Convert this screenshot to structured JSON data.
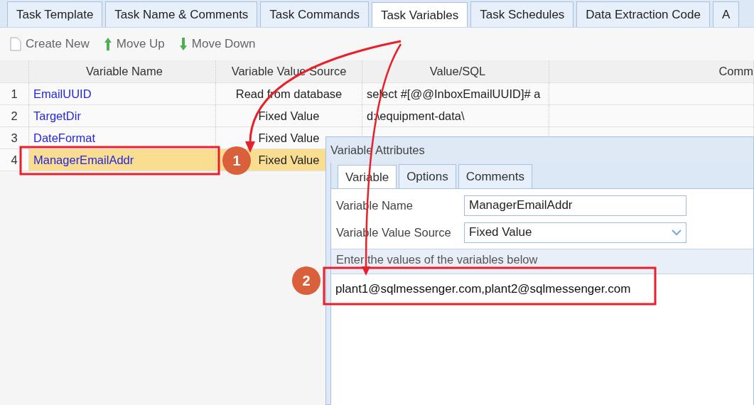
{
  "tabs": [
    {
      "label": "Task Template",
      "selected": false
    },
    {
      "label": "Task Name & Comments",
      "selected": false
    },
    {
      "label": "Task Commands",
      "selected": false
    },
    {
      "label": "Task Variables",
      "selected": true
    },
    {
      "label": "Task Schedules",
      "selected": false
    },
    {
      "label": "Data Extraction Code",
      "selected": false
    },
    {
      "label": "A",
      "selected": false
    }
  ],
  "toolbar": [
    {
      "kind": "new",
      "label": "Create New"
    },
    {
      "kind": "up",
      "label": "Move Up"
    },
    {
      "kind": "down",
      "label": "Move Down"
    }
  ],
  "table": {
    "columns": [
      "Variable Name",
      "Variable Value Source",
      "Value/SQL",
      "Comm"
    ],
    "rows": [
      {
        "number": "1",
        "name": "EmailUUID",
        "source": "Read from database",
        "value": "select #[@@InboxEmailUUID]# a",
        "selected": false
      },
      {
        "number": "2",
        "name": "TargetDir",
        "source": "Fixed Value",
        "value": "d:\\equipment-data\\",
        "selected": false
      },
      {
        "number": "3",
        "name": "DateFormat",
        "source": "Fixed Value",
        "selected": false
      },
      {
        "number": "4",
        "name": "ManagerEmailAddr",
        "source": "Fixed Value",
        "selected": true
      }
    ]
  },
  "dialog": {
    "title": "Variable Attributes",
    "tabs": [
      {
        "label": "Variable",
        "selected": true
      },
      {
        "label": "Options",
        "selected": false
      },
      {
        "label": "Comments",
        "selected": false
      }
    ],
    "fields": [
      {
        "kind": "text",
        "label": "Variable Name",
        "value": "ManagerEmailAddr"
      },
      {
        "kind": "dropdown",
        "label": "Variable Value Source",
        "value": "Fixed Value"
      }
    ],
    "section_label": "Enter the values of the variables below",
    "values_text": "plant1@sqlmessenger.com,plant2@sqlmessenger.com"
  },
  "callouts": [
    {
      "label": "1"
    },
    {
      "label": "2"
    }
  ]
}
